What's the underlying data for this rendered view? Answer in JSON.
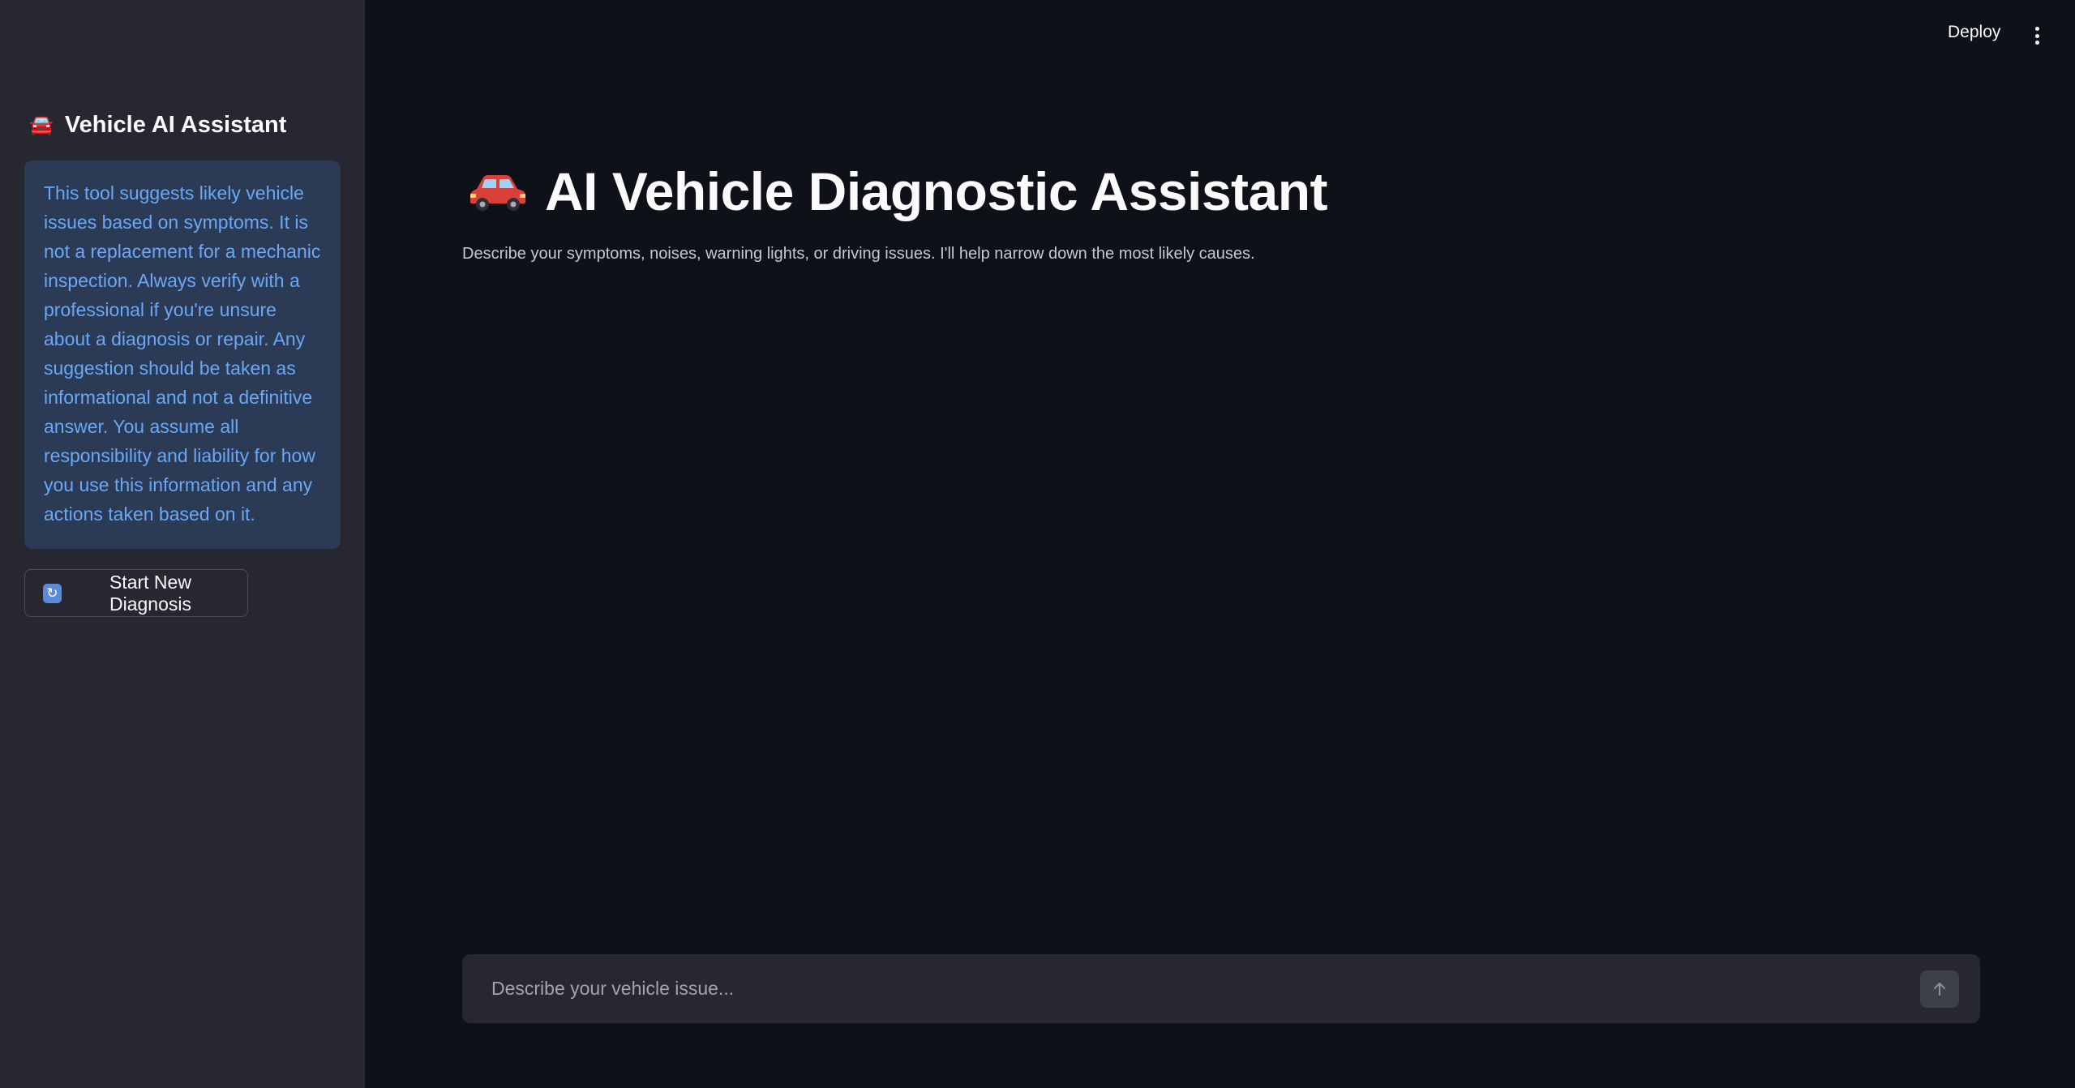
{
  "sidebar": {
    "title": "Vehicle AI Assistant",
    "title_emoji": "🚘",
    "disclaimer": "This tool suggests likely vehicle issues based on symptoms. It is not a replacement for a mechanic inspection. Always verify with a professional if you're unsure about a diagnosis or repair. Any suggestion should be taken as informational and not a definitive answer. You assume all responsibility and liability for how you use this information and any actions taken based on it.",
    "new_diagnosis_label": "Start New Diagnosis",
    "new_diagnosis_icon": "refresh-icon"
  },
  "header": {
    "deploy_label": "Deploy",
    "menu_icon": "kebab-menu-icon"
  },
  "main": {
    "title": "AI Vehicle Diagnostic Assistant",
    "title_icon": "car-icon",
    "subtitle": "Describe your symptoms, noises, warning lights, or driving issues. I'll help narrow down the most likely causes."
  },
  "chat": {
    "placeholder": "Describe your vehicle issue...",
    "value": "",
    "send_icon": "arrow-up-icon"
  },
  "colors": {
    "background": "#0e1117",
    "sidebar": "#262730",
    "info_box": "#2b3a55",
    "info_text": "#6aa8f7",
    "car_red": "#d9403a"
  }
}
